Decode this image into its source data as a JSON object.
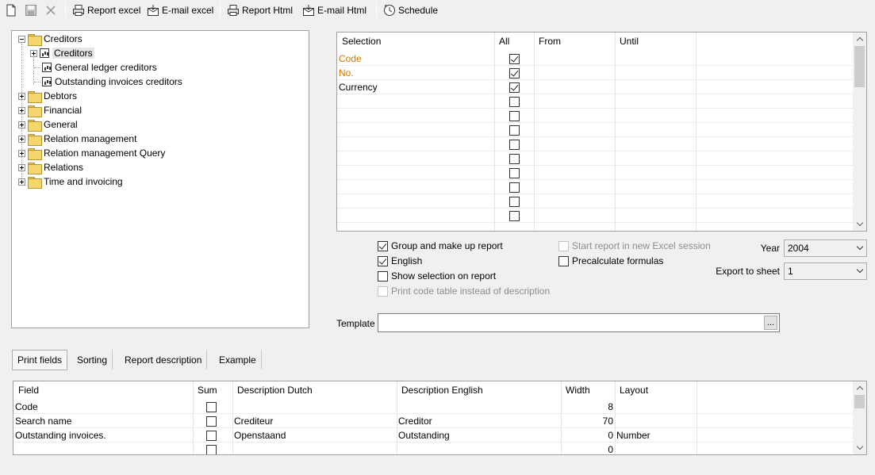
{
  "toolbar": {
    "report_excel": "Report excel",
    "email_excel": "E-mail excel",
    "report_html": "Report Html",
    "email_html": "E-mail Html",
    "schedule": "Schedule"
  },
  "tree": {
    "root": "Creditors",
    "children": [
      "Creditors",
      "General ledger creditors",
      "Outstanding invoices creditors"
    ],
    "others": [
      "Debtors",
      "Financial",
      "General",
      "Relation management",
      "Relation management Query",
      "Relations",
      "Time and invoicing"
    ]
  },
  "selection_grid": {
    "headers": {
      "selection": "Selection",
      "all": "All",
      "from": "From",
      "until": "Until"
    },
    "rows": [
      {
        "label": "Code",
        "checked": true
      },
      {
        "label": "No.",
        "checked": true
      },
      {
        "label": "Currency",
        "checked": true
      },
      {
        "label": "",
        "checked": false
      },
      {
        "label": "",
        "checked": false
      },
      {
        "label": "",
        "checked": false
      },
      {
        "label": "",
        "checked": false
      },
      {
        "label": "",
        "checked": false
      },
      {
        "label": "",
        "checked": false
      },
      {
        "label": "",
        "checked": false
      },
      {
        "label": "",
        "checked": false
      },
      {
        "label": "",
        "checked": false
      }
    ]
  },
  "options": {
    "group_make_up": {
      "label": "Group and make up report",
      "checked": true
    },
    "english": {
      "label": "English",
      "checked": true
    },
    "show_selection": {
      "label": "Show selection on report",
      "checked": false
    },
    "print_code_table": {
      "label": "Print code table instead of description",
      "checked": false
    },
    "start_new_excel": {
      "label": "Start report in new Excel session",
      "checked": false
    },
    "precalculate": {
      "label": "Precalculate formulas",
      "checked": false
    }
  },
  "year": {
    "label": "Year",
    "value": "2004"
  },
  "export_sheet": {
    "label": "Export to sheet",
    "value": "1"
  },
  "template": {
    "label": "Template",
    "value": "",
    "browse": "..."
  },
  "tabs": [
    "Print fields",
    "Sorting",
    "Report description",
    "Example"
  ],
  "fields_grid": {
    "headers": {
      "field": "Field",
      "sum": "Sum",
      "desc_dutch": "Description Dutch",
      "desc_english": "Description English",
      "width": "Width",
      "layout": "Layout"
    },
    "rows": [
      {
        "field": "Code",
        "dutch": "",
        "english": "",
        "width": "8",
        "layout": ""
      },
      {
        "field": "Search name",
        "dutch": "Crediteur",
        "english": "Creditor",
        "width": "70",
        "layout": ""
      },
      {
        "field": "Outstanding invoices.",
        "dutch": "Openstaand",
        "english": "Outstanding",
        "width": "0",
        "layout": "Number"
      },
      {
        "field": "",
        "dutch": "",
        "english": "",
        "width": "0",
        "layout": ""
      }
    ]
  }
}
